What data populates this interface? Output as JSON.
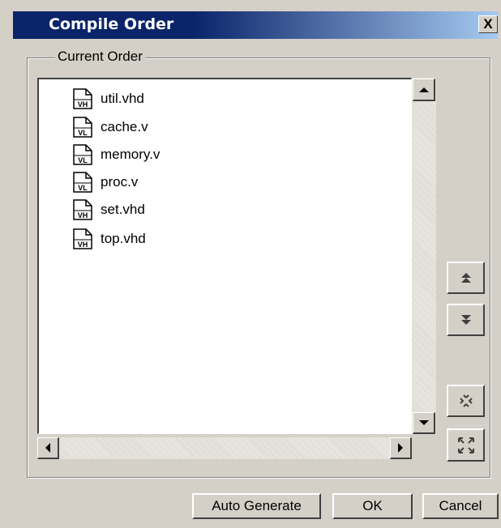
{
  "dialog": {
    "title": "Compile Order",
    "close_label": "X"
  },
  "group": {
    "legend": "Current Order"
  },
  "files": [
    {
      "name": "util.vhd",
      "type": "VH"
    },
    {
      "name": "cache.v",
      "type": "VL"
    },
    {
      "name": "memory.v",
      "type": "VL"
    },
    {
      "name": "proc.v",
      "type": "VL"
    },
    {
      "name": "set.vhd",
      "type": "VH"
    },
    {
      "name": "top.vhd",
      "type": "VH"
    }
  ],
  "buttons": {
    "auto_generate": "Auto Generate",
    "ok": "OK",
    "cancel": "Cancel"
  },
  "icons": {
    "move_up": "double-up-arrow-icon",
    "move_down": "double-down-arrow-icon",
    "collapse": "collapse-icon",
    "expand": "expand-icon"
  }
}
